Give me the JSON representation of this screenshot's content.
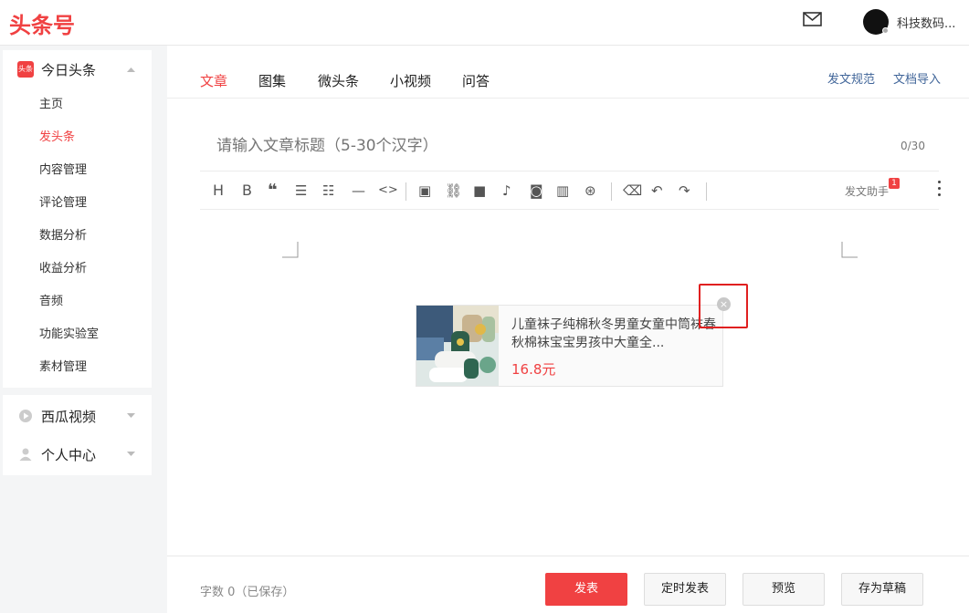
{
  "header": {
    "logo": "头条号",
    "user_name": "科技数码..."
  },
  "sidebar": {
    "sections": [
      {
        "label": "今日头条",
        "badge": "头条",
        "items": [
          "主页",
          "发头条",
          "内容管理",
          "评论管理",
          "数据分析",
          "收益分析",
          "音频",
          "功能实验室",
          "素材管理"
        ],
        "active": "发头条"
      },
      {
        "label": "西瓜视频"
      },
      {
        "label": "个人中心"
      }
    ]
  },
  "tabs": {
    "items": [
      "文章",
      "图集",
      "微头条",
      "小视频",
      "问答"
    ],
    "active": "文章",
    "links": [
      "发文规范",
      "文档导入"
    ]
  },
  "editor": {
    "title_placeholder": "请输入文章标题（5-30个汉字）",
    "title_count": "0/30",
    "assistant_label": "发文助手",
    "assistant_badge": "1"
  },
  "product_card": {
    "title": "儿童袜子纯棉秋冬男童女童中筒袜春秋棉袜宝宝男孩中大童全...",
    "price": "16.8元",
    "close": "×"
  },
  "footer": {
    "word_count": "字数 0（已保存）",
    "publish": "发表",
    "schedule": "定时发表",
    "preview": "预览",
    "save_draft": "存为草稿"
  },
  "colors": {
    "brand": "#f04142",
    "link": "#406599"
  }
}
